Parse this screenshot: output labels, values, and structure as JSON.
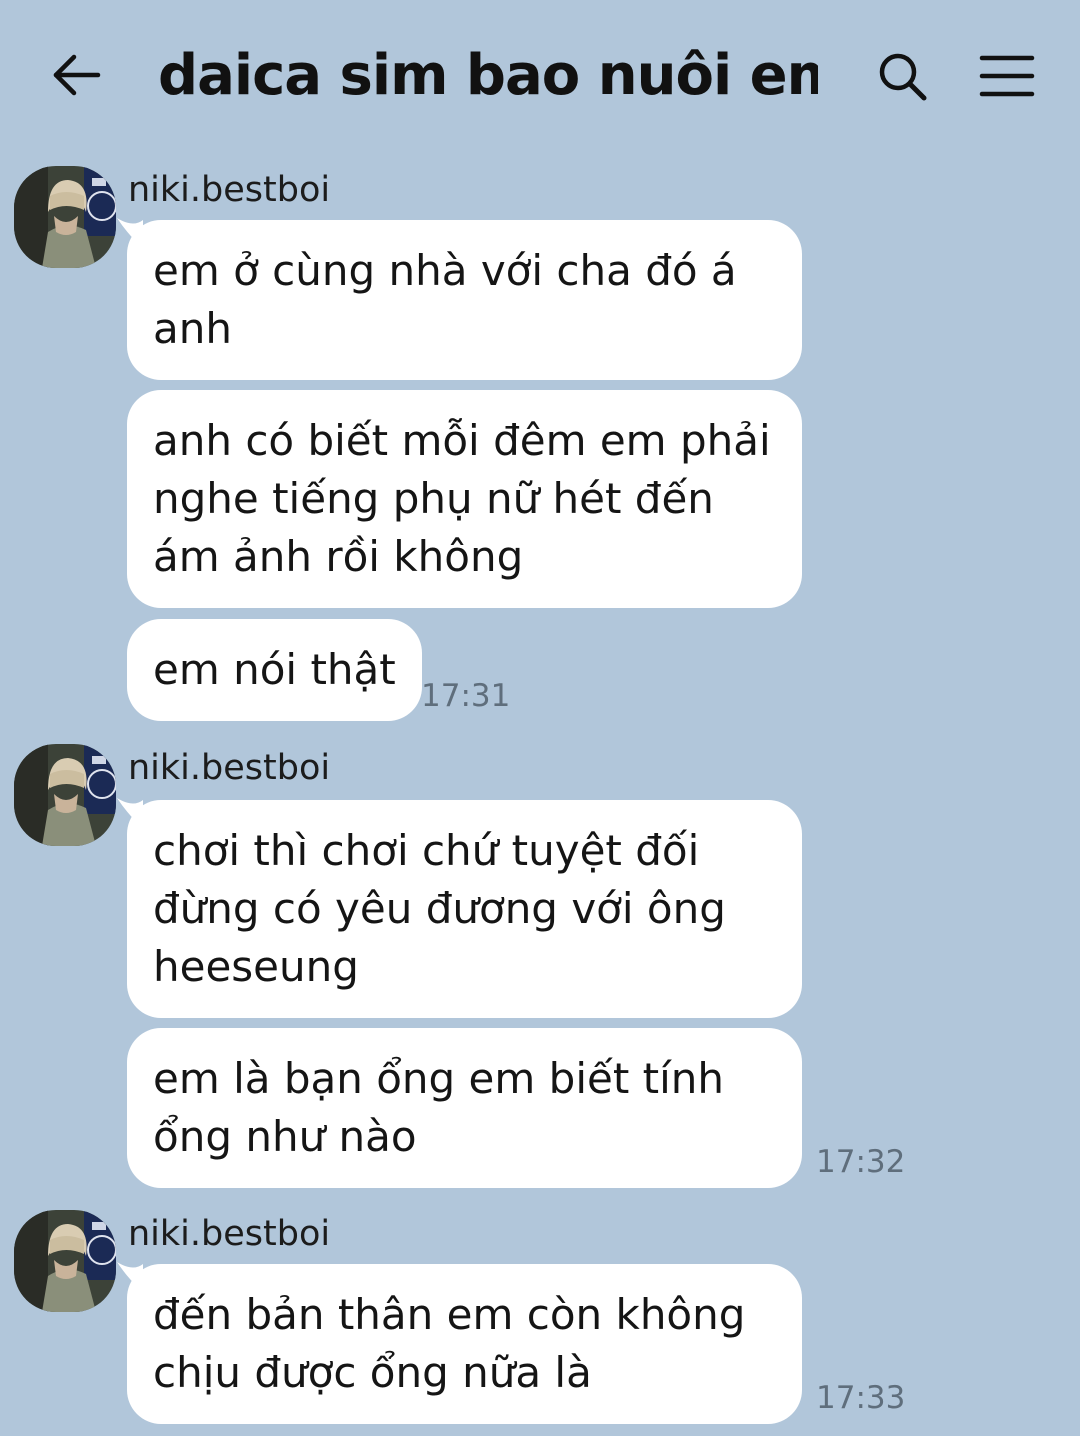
{
  "header": {
    "title": "daica sim bao nuôi em đi..."
  },
  "colors": {
    "background": "#b1c6da",
    "bubble": "#ffffff",
    "timestamp": "#5f6e7c"
  },
  "groups": [
    {
      "sender": "niki.bestboi",
      "messages": [
        "em ở cùng nhà với cha đó á anh",
        "anh có biết mỗi đêm em phải nghe tiếng phụ nữ hét đến ám ảnh rồi không",
        "em nói thật"
      ],
      "time": "17:31"
    },
    {
      "sender": "niki.bestboi",
      "messages": [
        "chơi thì chơi chứ tuyệt đối đừng có yêu đương với ông heeseung",
        "em là bạn ổng em biết tính ổng như nào"
      ],
      "time": "17:32"
    },
    {
      "sender": "niki.bestboi",
      "messages": [
        "đến bản thân em còn không chịu được ổng nữa là"
      ],
      "time": "17:33"
    }
  ]
}
